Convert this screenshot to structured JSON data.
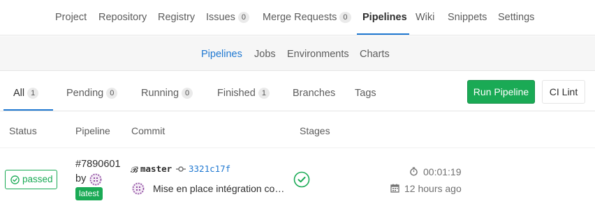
{
  "top_nav": {
    "project": "Project",
    "repository": "Repository",
    "registry": "Registry",
    "issues": "Issues",
    "issues_count": "0",
    "merge_requests": "Merge Requests",
    "merge_requests_count": "0",
    "pipelines": "Pipelines",
    "wiki": "Wiki",
    "snippets": "Snippets",
    "settings": "Settings",
    "active": "Pipelines"
  },
  "sub_nav": {
    "pipelines": "Pipelines",
    "jobs": "Jobs",
    "environments": "Environments",
    "charts": "Charts",
    "active": "Pipelines"
  },
  "scope_tabs": {
    "all": "All",
    "all_count": "1",
    "pending": "Pending",
    "pending_count": "0",
    "running": "Running",
    "running_count": "0",
    "finished": "Finished",
    "finished_count": "1",
    "branches": "Branches",
    "tags": "Tags",
    "active": "All"
  },
  "actions": {
    "run_pipeline": "Run Pipeline",
    "ci_lint": "CI Lint"
  },
  "table": {
    "headers": {
      "status": "Status",
      "pipeline": "Pipeline",
      "commit": "Commit",
      "stages": "Stages"
    },
    "rows": [
      {
        "status": "passed",
        "pipeline_id": "#7890601",
        "by": "by",
        "badge": "latest",
        "branch": "master",
        "sha": "3321c17f",
        "message": "Mise en place intégration continue",
        "duration": "00:01:19",
        "finished_ago": "12 hours ago"
      }
    ]
  },
  "colors": {
    "accent": "#1f78d1",
    "success": "#1aaa55",
    "muted": "#707070"
  },
  "icons": {
    "status": "check-circle-icon",
    "branch": "branch-icon",
    "commit": "commit-icon",
    "stage": "check-circle-icon",
    "duration": "timer-icon",
    "finished": "calendar-icon",
    "avatar": "identicon"
  }
}
